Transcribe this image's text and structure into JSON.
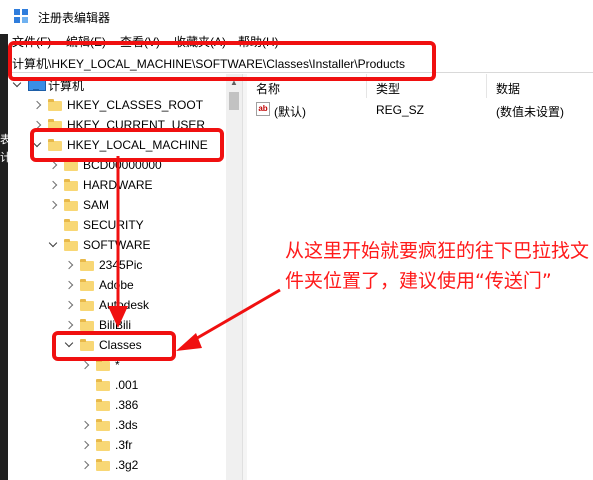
{
  "window": {
    "title": "注册表编辑器",
    "icon": "regedit-icon"
  },
  "menu": [
    {
      "label": "文件(F)"
    },
    {
      "label": "编辑(E)"
    },
    {
      "label": "查看(V)"
    },
    {
      "label": "收藏夹(A)"
    },
    {
      "label": "帮助(H)"
    }
  ],
  "address": {
    "path": "计算机\\HKEY_LOCAL_MACHINE\\SOFTWARE\\Classes\\Installer\\Products"
  },
  "tree": {
    "root": "计算机",
    "items": [
      {
        "label": "HKEY_CLASSES_ROOT",
        "expanded": false
      },
      {
        "label": "HKEY_CURRENT_USER",
        "expanded": false
      },
      {
        "label": "HKEY_LOCAL_MACHINE",
        "expanded": true
      },
      {
        "label": "BCD00000000",
        "expanded": false
      },
      {
        "label": "HARDWARE",
        "expanded": false
      },
      {
        "label": "SAM",
        "expanded": false
      },
      {
        "label": "SECURITY",
        "expanded": false
      },
      {
        "label": "SOFTWARE",
        "expanded": true
      },
      {
        "label": "2345Pic",
        "expanded": false
      },
      {
        "label": "Adobe",
        "expanded": false
      },
      {
        "label": "Autodesk",
        "expanded": false
      },
      {
        "label": "BiliBili",
        "expanded": false
      },
      {
        "label": "Classes",
        "expanded": true
      },
      {
        "label": "*",
        "expanded": false
      },
      {
        "label": ".001",
        "expanded": false
      },
      {
        "label": ".386",
        "expanded": false
      },
      {
        "label": ".3ds",
        "expanded": false
      },
      {
        "label": ".3fr",
        "expanded": false
      },
      {
        "label": ".3g2",
        "expanded": false
      }
    ]
  },
  "list": {
    "columns": [
      "名称",
      "类型",
      "数据"
    ],
    "rows": [
      {
        "name": "(默认)",
        "type": "REG_SZ",
        "data": "(数值未设置)",
        "icon": "string-value-icon"
      }
    ]
  },
  "annotation": {
    "text": "从这里开始就要疯狂的往下巴拉找文件夹位置了，建议使用“传送门”",
    "color": "#f01010"
  },
  "background_window": {
    "chars": [
      "表",
      "计"
    ]
  }
}
